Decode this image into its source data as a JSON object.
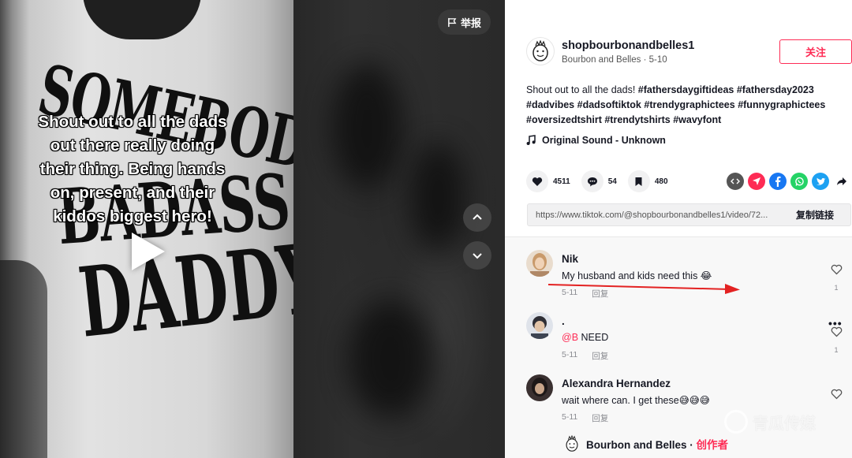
{
  "video": {
    "shirt_print": [
      "SOMEBODY'S",
      "BADASS",
      "DADDY"
    ],
    "caption_lines": [
      "Shout out to all the dads",
      "out there really doing",
      "their thing. Being hands",
      "on, present, and their",
      "kiddos biggest hero!"
    ],
    "report_label": "举报"
  },
  "author": {
    "username": "shopbourbonandbelles1",
    "display_name": "Bourbon and Belles",
    "date": "5-10",
    "follow_label": "关注"
  },
  "description": {
    "text": "Shout out to all the dads!",
    "hashtags": [
      "#fathersdaygiftideas",
      "#fathersday2023",
      "#dadvibes",
      "#dadsoftiktok",
      "#trendygraphictees",
      "#funnygraphictees",
      "#oversizedtshirt",
      "#trendytshirts",
      "#wavyfont"
    ]
  },
  "music": {
    "title": "Original Sound - Unknown"
  },
  "actions": {
    "likes": "4511",
    "comments": "54",
    "saves": "480"
  },
  "share_icons": [
    "embed-icon",
    "send-icon",
    "facebook-icon",
    "whatsapp-icon",
    "twitter-icon",
    "share-arrow-icon"
  ],
  "link": {
    "url": "https://www.tiktok.com/@shopbourbonandbelles1/video/72...",
    "copy_label": "复制链接"
  },
  "comments": [
    {
      "name": "Nik",
      "text": "My husband and kids need this 😂",
      "date": "5-11",
      "reply_label": "回复",
      "likes": "1"
    },
    {
      "name": ".",
      "mention": "@B",
      "text": "NEED",
      "date": "5-11",
      "reply_label": "回复",
      "likes": "1"
    },
    {
      "name": "Alexandra Hernandez",
      "text": "wait where can. I get these😅😅😅",
      "date": "5-11",
      "reply_label": "回复",
      "likes": ""
    }
  ],
  "creator_reply": {
    "name": "Bourbon and Belles · ",
    "tag": "创作者"
  },
  "watermark": {
    "text": "青瓜传媒"
  },
  "colors": {
    "accent": "#fe2c55",
    "facebook": "#1877f2",
    "whatsapp": "#25d366",
    "twitter": "#1da1f2",
    "send": "#fe2c55",
    "embed": "#555555"
  }
}
